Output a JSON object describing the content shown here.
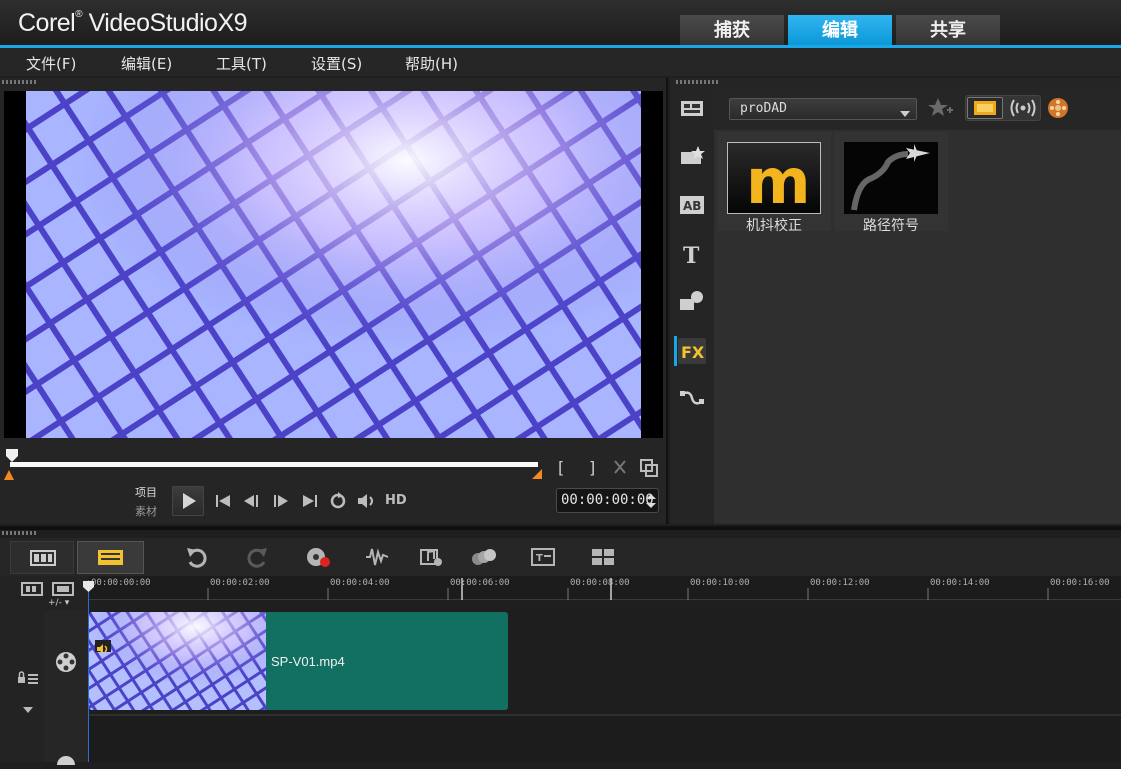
{
  "app": {
    "brand_prefix": "Corel",
    "brand_reg": "®",
    "brand_name": " VideoStudio",
    "brand_version": "X9"
  },
  "main_tabs": [
    {
      "label": "捕获"
    },
    {
      "label": "编辑",
      "active": true
    },
    {
      "label": "共享"
    }
  ],
  "menu": [
    {
      "label": "文件(F)"
    },
    {
      "label": "编辑(E)"
    },
    {
      "label": "工具(T)"
    },
    {
      "label": "设置(S)"
    },
    {
      "label": "帮助(H)"
    }
  ],
  "player": {
    "project_label": "项目",
    "clip_label": "素材",
    "hd_label": "HD",
    "timecode": "00:00:00:00",
    "mark_in": "[",
    "mark_out": "]"
  },
  "library": {
    "category": "proDAD",
    "items": [
      {
        "caption": "机抖校正"
      },
      {
        "caption": "路径符号"
      }
    ]
  },
  "timeline": {
    "ticks": [
      "00:00:00:00",
      "00:00:02:00",
      "00:00:04:00",
      "00:00:06:00",
      "00:00:08:00",
      "00:00:10:00",
      "00:00:12:00",
      "00:00:14:00",
      "00:00:16:00"
    ],
    "zoom_label": "+/-",
    "clip_name": "SP-V01.mp4"
  },
  "colors": {
    "accent": "#1aa7e6",
    "clip": "#117062",
    "fx_icon": "#f2c230"
  }
}
